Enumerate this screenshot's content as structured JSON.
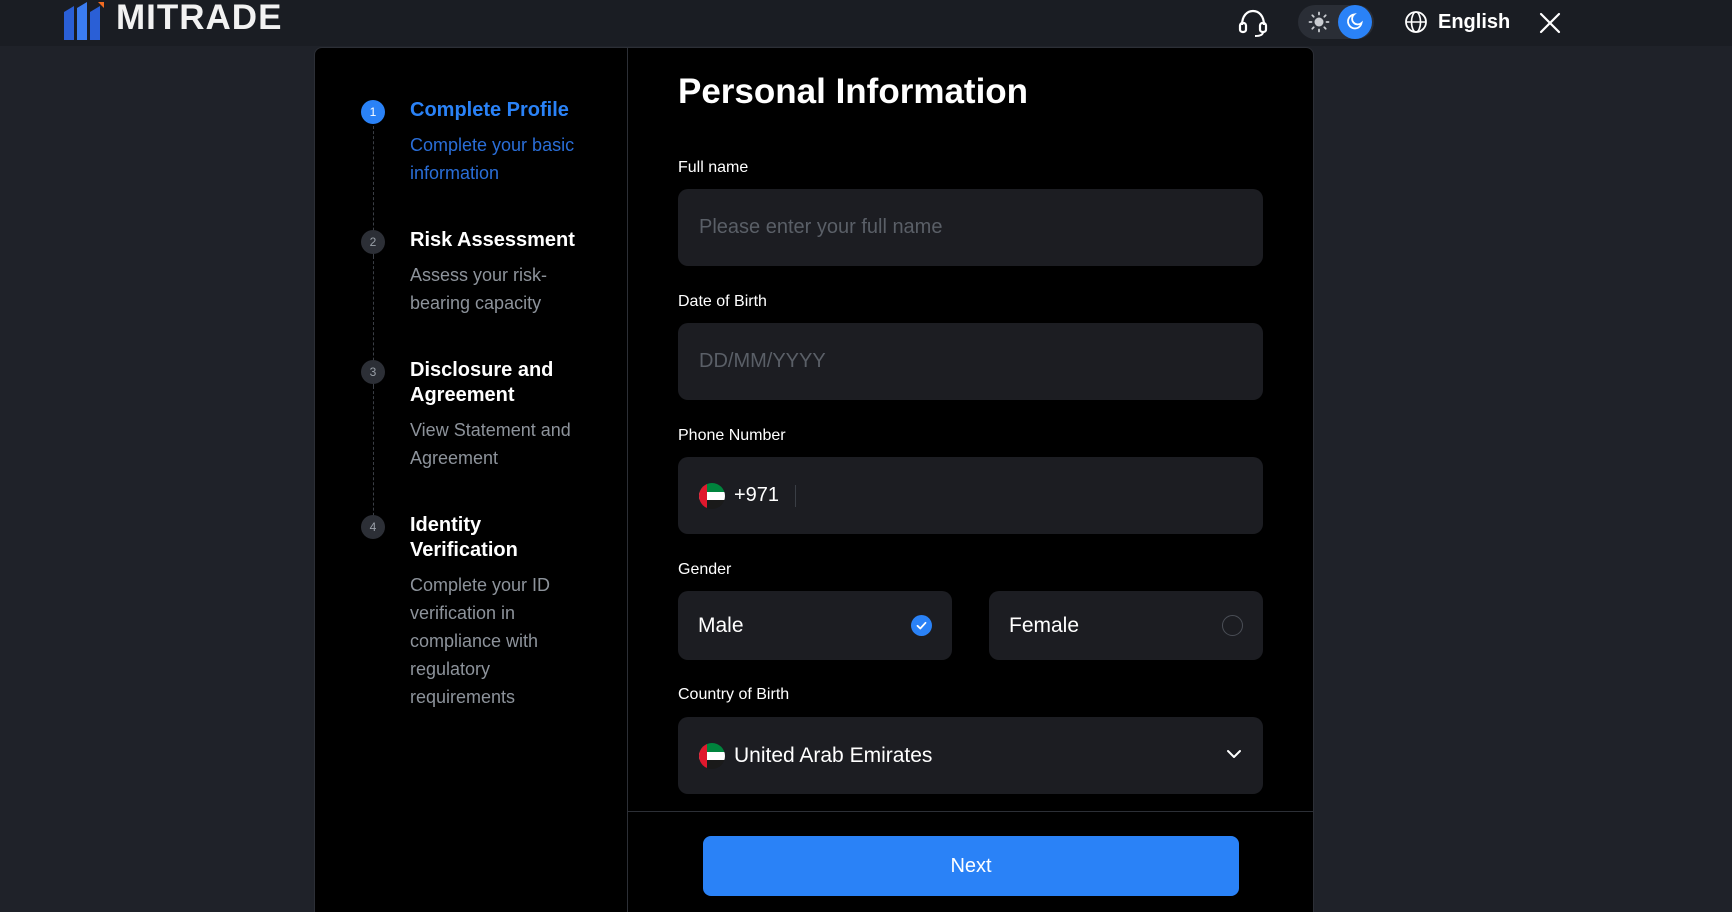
{
  "header": {
    "brand": "MITRADE",
    "language": "English",
    "icons": {
      "support": "headset-icon",
      "light": "sun-icon",
      "dark": "moon-icon",
      "language": "globe-icon",
      "close": "close-icon"
    },
    "theme_active": "dark"
  },
  "stepper": {
    "steps": [
      {
        "number": "1",
        "title": "Complete Profile",
        "description": "Complete your basic information",
        "state": "active"
      },
      {
        "number": "2",
        "title": "Risk Assessment",
        "description": "Assess your risk-bearing capacity",
        "state": "pending"
      },
      {
        "number": "3",
        "title": "Disclosure and Agreement",
        "description": "View Statement and Agreement",
        "state": "pending"
      },
      {
        "number": "4",
        "title": "Identity Verification",
        "description": "Complete your ID verification in compliance with regulatory requirements",
        "state": "pending"
      }
    ]
  },
  "form": {
    "title": "Personal Information",
    "full_name": {
      "label": "Full name",
      "placeholder": "Please enter your full name",
      "value": ""
    },
    "dob": {
      "label": "Date of Birth",
      "placeholder": "DD/MM/YYYY",
      "value": ""
    },
    "phone": {
      "label": "Phone Number",
      "dial_code": "+971",
      "flag": "uae-flag-icon",
      "value": ""
    },
    "gender": {
      "label": "Gender",
      "options": [
        {
          "label": "Male",
          "selected": true
        },
        {
          "label": "Female",
          "selected": false
        }
      ]
    },
    "country_of_birth": {
      "label": "Country of Birth",
      "value": "United Arab Emirates",
      "flag": "uae-flag-icon"
    },
    "next_label": "Next"
  },
  "colors": {
    "accent": "#2a82f7",
    "page_bg": "#1f2229",
    "card_bg": "#000000",
    "field_bg": "#1c1d22"
  }
}
